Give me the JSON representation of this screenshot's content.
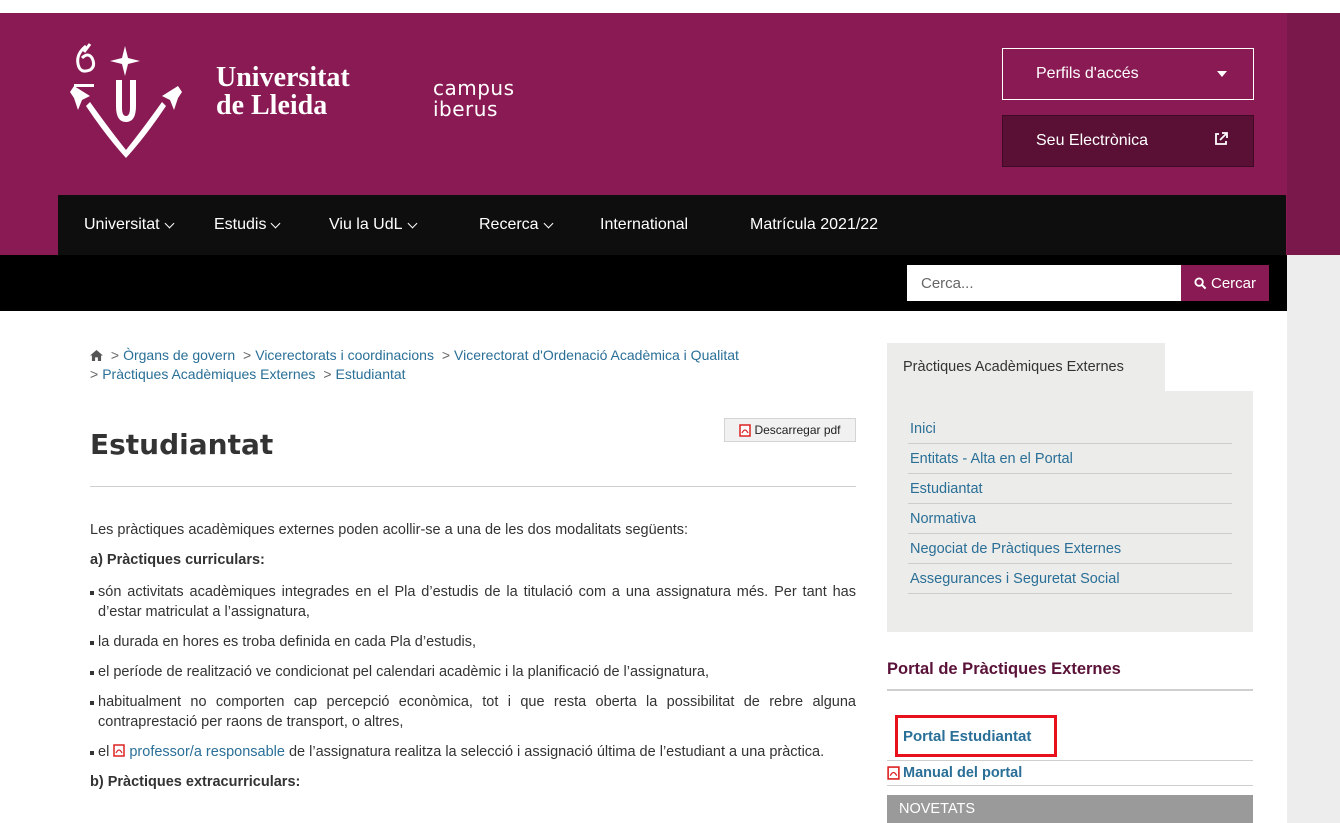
{
  "colors": {
    "brand": "#8a1a54",
    "dark_brand": "#5a0f35",
    "nav_bg": "#0e0e0e",
    "link": "#2a6f97",
    "highlight": "#e8101b"
  },
  "header": {
    "logo": {
      "line1": "Universitat",
      "line2": "de Lleida",
      "campus_line1": "campus",
      "campus_line2": "iberus"
    },
    "perfils_label": "Perfils d'accés",
    "seu_label": "Seu Electrònica"
  },
  "nav": {
    "items": [
      {
        "label": "Universitat",
        "has_dropdown": true
      },
      {
        "label": "Estudis",
        "has_dropdown": true
      },
      {
        "label": "Viu la UdL",
        "has_dropdown": true
      },
      {
        "label": "Recerca",
        "has_dropdown": true
      },
      {
        "label": "International",
        "has_dropdown": false
      },
      {
        "label": "Matrícula 2021/22",
        "has_dropdown": false
      }
    ]
  },
  "search": {
    "placeholder": "Cerca...",
    "button_label": "Cercar"
  },
  "breadcrumb": {
    "sep": ">",
    "items": [
      "Òrgans de govern",
      "Vicerectorats i coordinacions",
      "Vicerectorat d'Ordenació Acadèmica i Qualitat",
      "Pràctiques Acadèmiques Externes",
      "Estudiantat"
    ]
  },
  "main": {
    "pdf_label": "Descarregar pdf",
    "title": "Estudiantat",
    "intro": "Les pràctiques acadèmiques externes poden acollir-se a una de les dos modalitats següents:",
    "section_a": "a) Pràctiques curriculars:",
    "bullets": [
      "són activitats acadèmiques integrades en el Pla d’estudis de la titulació com a una assignatura més. Per tant has d’estar matriculat a l’assignatura,",
      "la durada en hores es troba definida en cada Pla d’estudis,",
      "el període de realització ve condicionat pel calendari acadèmic i la planificació de l’assignatura,",
      "habitualment no comporten cap percepció econòmica, tot i que resta oberta la possibilitat de rebre alguna contraprestació per raons de transport, o altres,"
    ],
    "last_bullet": {
      "prefix": "el",
      "link": "professor/a responsable",
      "suffix": "de l’assignatura realitza la selecció i assignació última de l’estudiant a una pràctica."
    },
    "section_b": "b) Pràctiques extracurriculars:"
  },
  "sidebar": {
    "tab_label": "Pràctiques Acadèmiques Externes",
    "items": [
      "Inici",
      "Entitats - Alta en el Portal",
      "Estudiantat",
      "Normativa",
      "Negociat de Pràctiques Externes",
      "Assegurances i Seguretat Social"
    ],
    "portal_heading": "Portal de Pràctiques Externes",
    "portal_estudiantat": "Portal Estudiantat",
    "manual": "Manual del portal",
    "novetats": "NOVETATS"
  }
}
